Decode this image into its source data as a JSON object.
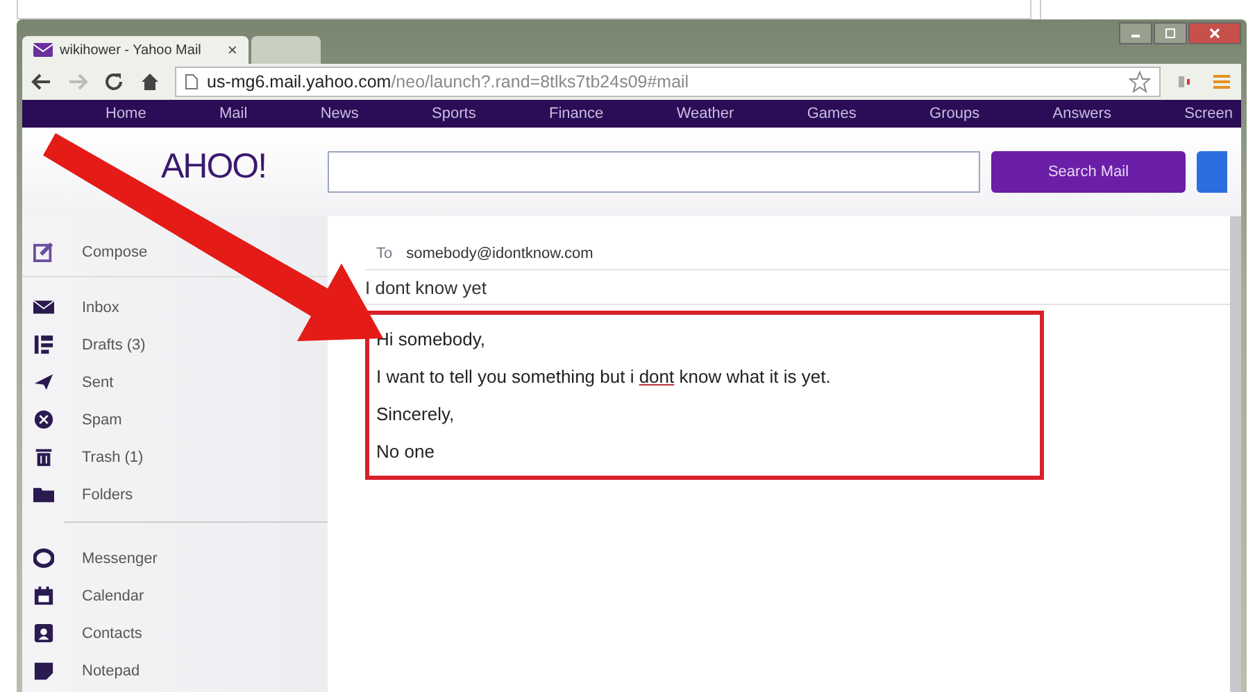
{
  "browser": {
    "tabs": [
      {
        "title": "wikihower - Yahoo Mail",
        "close": "×",
        "selected": true
      },
      {
        "selected": false
      }
    ],
    "address": {
      "host": "us-mg6.mail.yahoo.com",
      "path": "/neo/launch?.rand=8tlks7tb24s09#mail"
    }
  },
  "nav": [
    "Home",
    "Mail",
    "News",
    "Sports",
    "Finance",
    "Weather",
    "Games",
    "Groups",
    "Answers",
    "Screen"
  ],
  "logo": "AHOO!",
  "search": {
    "button": "Search Mail"
  },
  "sidebar": {
    "items": [
      "Compose",
      "Inbox",
      "Drafts (3)",
      "Sent",
      "Spam",
      "Trash (1)",
      "Folders"
    ],
    "apps": [
      "Messenger",
      "Calendar",
      "Contacts",
      "Notepad"
    ]
  },
  "compose": {
    "to_label": "To",
    "to": "somebody@idontknow.com",
    "subject": "I dont know yet",
    "body": [
      {
        "before": "Hi somebody,"
      },
      {
        "before": "I want to tell you something but i ",
        "misspelled": "dont",
        "after": " know what it is yet."
      },
      {
        "before": "Sincerely,"
      },
      {
        "before": "No one"
      }
    ]
  }
}
